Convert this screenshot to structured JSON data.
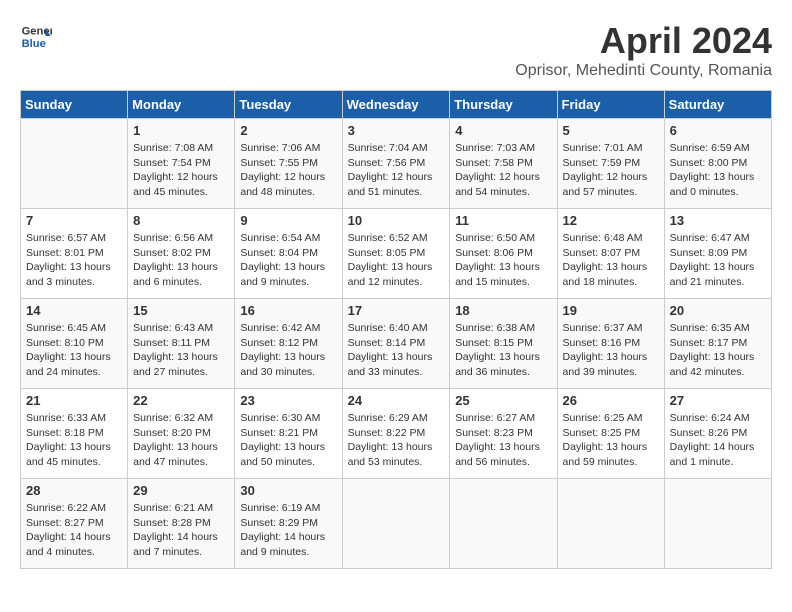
{
  "header": {
    "logo_line1": "General",
    "logo_line2": "Blue",
    "month": "April 2024",
    "location": "Oprisor, Mehedinti County, Romania"
  },
  "days_of_week": [
    "Sunday",
    "Monday",
    "Tuesday",
    "Wednesday",
    "Thursday",
    "Friday",
    "Saturday"
  ],
  "weeks": [
    [
      {
        "day": "",
        "info": ""
      },
      {
        "day": "1",
        "info": "Sunrise: 7:08 AM\nSunset: 7:54 PM\nDaylight: 12 hours\nand 45 minutes."
      },
      {
        "day": "2",
        "info": "Sunrise: 7:06 AM\nSunset: 7:55 PM\nDaylight: 12 hours\nand 48 minutes."
      },
      {
        "day": "3",
        "info": "Sunrise: 7:04 AM\nSunset: 7:56 PM\nDaylight: 12 hours\nand 51 minutes."
      },
      {
        "day": "4",
        "info": "Sunrise: 7:03 AM\nSunset: 7:58 PM\nDaylight: 12 hours\nand 54 minutes."
      },
      {
        "day": "5",
        "info": "Sunrise: 7:01 AM\nSunset: 7:59 PM\nDaylight: 12 hours\nand 57 minutes."
      },
      {
        "day": "6",
        "info": "Sunrise: 6:59 AM\nSunset: 8:00 PM\nDaylight: 13 hours\nand 0 minutes."
      }
    ],
    [
      {
        "day": "7",
        "info": "Sunrise: 6:57 AM\nSunset: 8:01 PM\nDaylight: 13 hours\nand 3 minutes."
      },
      {
        "day": "8",
        "info": "Sunrise: 6:56 AM\nSunset: 8:02 PM\nDaylight: 13 hours\nand 6 minutes."
      },
      {
        "day": "9",
        "info": "Sunrise: 6:54 AM\nSunset: 8:04 PM\nDaylight: 13 hours\nand 9 minutes."
      },
      {
        "day": "10",
        "info": "Sunrise: 6:52 AM\nSunset: 8:05 PM\nDaylight: 13 hours\nand 12 minutes."
      },
      {
        "day": "11",
        "info": "Sunrise: 6:50 AM\nSunset: 8:06 PM\nDaylight: 13 hours\nand 15 minutes."
      },
      {
        "day": "12",
        "info": "Sunrise: 6:48 AM\nSunset: 8:07 PM\nDaylight: 13 hours\nand 18 minutes."
      },
      {
        "day": "13",
        "info": "Sunrise: 6:47 AM\nSunset: 8:09 PM\nDaylight: 13 hours\nand 21 minutes."
      }
    ],
    [
      {
        "day": "14",
        "info": "Sunrise: 6:45 AM\nSunset: 8:10 PM\nDaylight: 13 hours\nand 24 minutes."
      },
      {
        "day": "15",
        "info": "Sunrise: 6:43 AM\nSunset: 8:11 PM\nDaylight: 13 hours\nand 27 minutes."
      },
      {
        "day": "16",
        "info": "Sunrise: 6:42 AM\nSunset: 8:12 PM\nDaylight: 13 hours\nand 30 minutes."
      },
      {
        "day": "17",
        "info": "Sunrise: 6:40 AM\nSunset: 8:14 PM\nDaylight: 13 hours\nand 33 minutes."
      },
      {
        "day": "18",
        "info": "Sunrise: 6:38 AM\nSunset: 8:15 PM\nDaylight: 13 hours\nand 36 minutes."
      },
      {
        "day": "19",
        "info": "Sunrise: 6:37 AM\nSunset: 8:16 PM\nDaylight: 13 hours\nand 39 minutes."
      },
      {
        "day": "20",
        "info": "Sunrise: 6:35 AM\nSunset: 8:17 PM\nDaylight: 13 hours\nand 42 minutes."
      }
    ],
    [
      {
        "day": "21",
        "info": "Sunrise: 6:33 AM\nSunset: 8:18 PM\nDaylight: 13 hours\nand 45 minutes."
      },
      {
        "day": "22",
        "info": "Sunrise: 6:32 AM\nSunset: 8:20 PM\nDaylight: 13 hours\nand 47 minutes."
      },
      {
        "day": "23",
        "info": "Sunrise: 6:30 AM\nSunset: 8:21 PM\nDaylight: 13 hours\nand 50 minutes."
      },
      {
        "day": "24",
        "info": "Sunrise: 6:29 AM\nSunset: 8:22 PM\nDaylight: 13 hours\nand 53 minutes."
      },
      {
        "day": "25",
        "info": "Sunrise: 6:27 AM\nSunset: 8:23 PM\nDaylight: 13 hours\nand 56 minutes."
      },
      {
        "day": "26",
        "info": "Sunrise: 6:25 AM\nSunset: 8:25 PM\nDaylight: 13 hours\nand 59 minutes."
      },
      {
        "day": "27",
        "info": "Sunrise: 6:24 AM\nSunset: 8:26 PM\nDaylight: 14 hours\nand 1 minute."
      }
    ],
    [
      {
        "day": "28",
        "info": "Sunrise: 6:22 AM\nSunset: 8:27 PM\nDaylight: 14 hours\nand 4 minutes."
      },
      {
        "day": "29",
        "info": "Sunrise: 6:21 AM\nSunset: 8:28 PM\nDaylight: 14 hours\nand 7 minutes."
      },
      {
        "day": "30",
        "info": "Sunrise: 6:19 AM\nSunset: 8:29 PM\nDaylight: 14 hours\nand 9 minutes."
      },
      {
        "day": "",
        "info": ""
      },
      {
        "day": "",
        "info": ""
      },
      {
        "day": "",
        "info": ""
      },
      {
        "day": "",
        "info": ""
      }
    ]
  ]
}
